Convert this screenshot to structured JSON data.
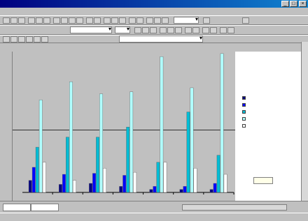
{
  "window": {
    "title": ""
  },
  "menu": {
    "items": [
      "",
      "",
      "",
      "",
      "",
      "",
      "",
      "",
      ""
    ]
  },
  "toolbar": {
    "font_name": "",
    "font_size": "",
    "zoom": ""
  },
  "formula_bar": {
    "name_box": "",
    "content": ""
  },
  "sheet_tabs": [
    "",
    ""
  ],
  "status": {
    "text": ""
  },
  "chart_data": {
    "type": "bar",
    "categories": [
      "",
      "",
      "",
      "",
      "",
      "",
      ""
    ],
    "series": [
      {
        "color": "#000080",
        "values": [
          12,
          8,
          9,
          6,
          3,
          3,
          3
        ]
      },
      {
        "color": "#0000ff",
        "values": [
          25,
          18,
          19,
          17,
          6,
          6,
          9
        ]
      },
      {
        "color": "#00bcd4",
        "values": [
          45,
          55,
          55,
          65,
          30,
          80,
          37
        ]
      },
      {
        "color": "#b0ffff",
        "values": [
          92,
          110,
          98,
          100,
          135,
          104,
          138
        ]
      },
      {
        "color": "#ffffff",
        "values": [
          30,
          12,
          24,
          20,
          30,
          24,
          18
        ]
      }
    ],
    "legend_labels": [
      "",
      "",
      "",
      "",
      ""
    ],
    "ylim": [
      0,
      140
    ],
    "reference_line": 62,
    "grid": false,
    "legend_position": "right",
    "button_label": ""
  },
  "colors": {
    "title_bar": "#000080",
    "plot_area": "#c0c0c0",
    "legend_background": "#ffffff"
  }
}
